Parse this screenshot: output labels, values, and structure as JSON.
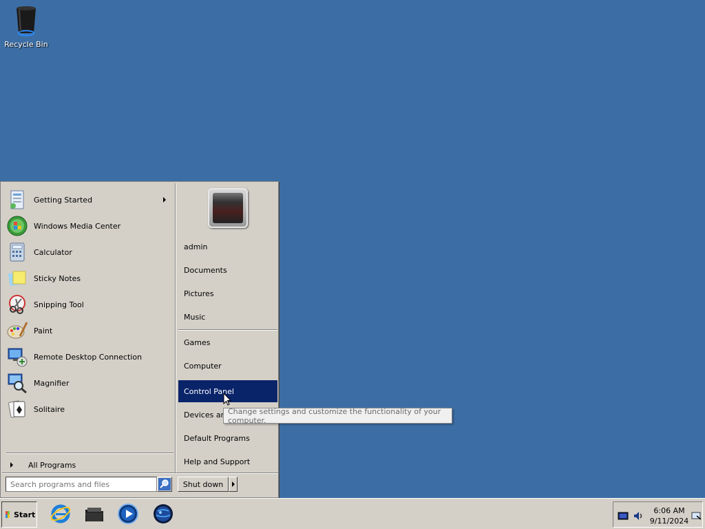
{
  "desktop": {
    "recycle_bin_label": "Recycle Bin"
  },
  "start_menu": {
    "programs": [
      {
        "label": "Getting Started",
        "icon": "getting-started-icon",
        "has_submenu": true
      },
      {
        "label": "Windows Media Center",
        "icon": "media-center-icon"
      },
      {
        "label": "Calculator",
        "icon": "calculator-icon"
      },
      {
        "label": "Sticky Notes",
        "icon": "sticky-notes-icon"
      },
      {
        "label": "Snipping Tool",
        "icon": "snipping-tool-icon"
      },
      {
        "label": "Paint",
        "icon": "paint-icon"
      },
      {
        "label": "Remote Desktop Connection",
        "icon": "remote-desktop-icon"
      },
      {
        "label": "Magnifier",
        "icon": "magnifier-icon"
      },
      {
        "label": "Solitaire",
        "icon": "solitaire-icon"
      }
    ],
    "all_programs_label": "All Programs",
    "right_items": [
      {
        "label": "admin"
      },
      {
        "label": "Documents"
      },
      {
        "label": "Pictures"
      },
      {
        "label": "Music"
      },
      {
        "label": "Games"
      },
      {
        "label": "Computer"
      },
      {
        "label": "Control Panel",
        "active": true
      },
      {
        "label": "Devices and Printers"
      },
      {
        "label": "Default Programs"
      },
      {
        "label": "Help and Support"
      }
    ],
    "search_placeholder": "Search programs and files",
    "shutdown_label": "Shut down",
    "highlight_color": "#0a246a"
  },
  "tooltip": {
    "text": "Change settings and customize the functionality of your computer."
  },
  "taskbar": {
    "start_label": "Start",
    "pinned": [
      {
        "name": "internet-explorer-icon"
      },
      {
        "name": "explorer-folder-icon"
      },
      {
        "name": "media-player-icon"
      },
      {
        "name": "network-globe-icon"
      }
    ],
    "clock_time": "6:06 AM",
    "clock_date": "9/11/2024"
  }
}
